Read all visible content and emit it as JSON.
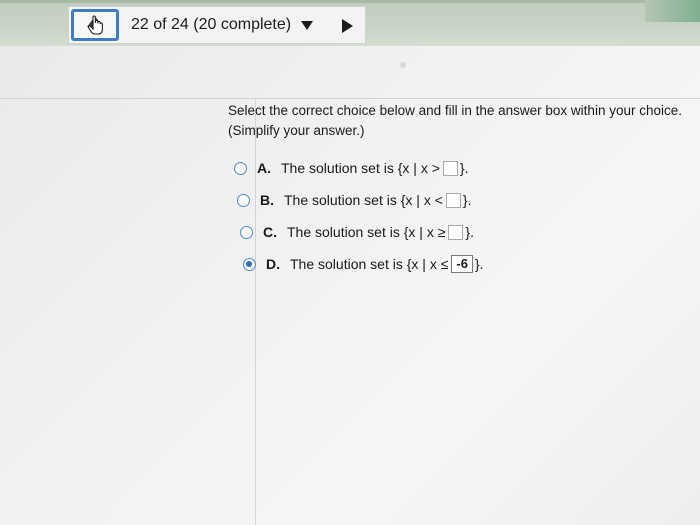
{
  "nav": {
    "progress": "22 of 24 (20 complete)",
    "back_icon": "hand-pointer-icon",
    "dropdown_icon": "triangle-down-icon",
    "next_icon": "triangle-right-icon"
  },
  "question": {
    "instruction": "Select the correct choice below and fill in the answer box within your choice.",
    "subinstruction": "(Simplify your answer.)",
    "choices": [
      {
        "letter": "A.",
        "prefix": "The solution set is {x | x >",
        "value": "",
        "suffix": "}.",
        "selected": false
      },
      {
        "letter": "B.",
        "prefix": "The solution set is {x | x <",
        "value": "",
        "suffix": "}.",
        "selected": false
      },
      {
        "letter": "C.",
        "prefix": "The solution set is {x | x ≥",
        "value": "",
        "suffix": "}.",
        "selected": false
      },
      {
        "letter": "D.",
        "prefix": "The solution set is {x | x ≤",
        "value": "-6",
        "suffix": "}.",
        "selected": true
      }
    ]
  },
  "colors": {
    "accent": "#3e7dc4",
    "top_bar": "#c8d4c6"
  }
}
